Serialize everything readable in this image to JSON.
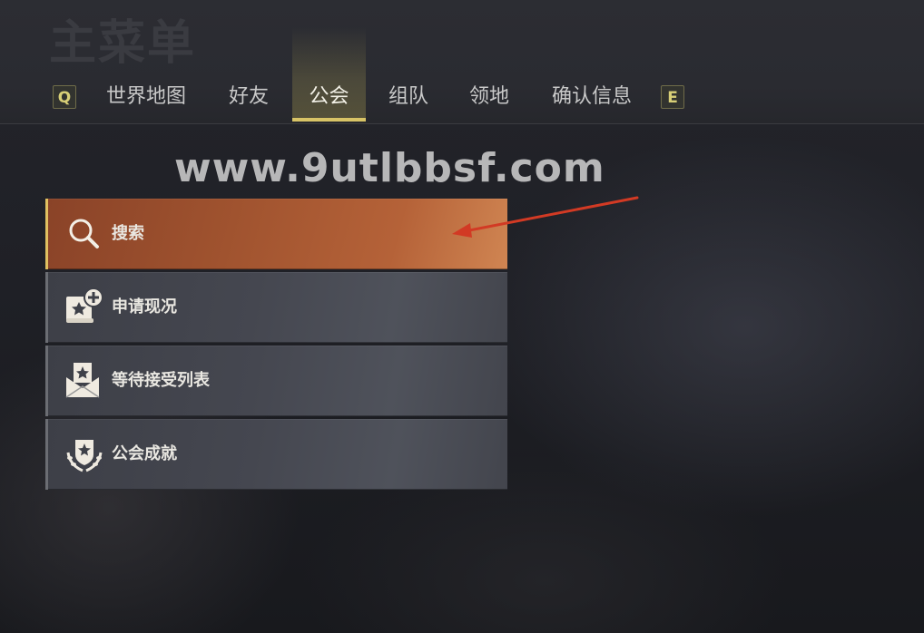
{
  "header": {
    "title": "主菜单",
    "left_key": "Q",
    "right_key": "E",
    "tabs": [
      {
        "label": "世界地图",
        "active": false
      },
      {
        "label": "好友",
        "active": false
      },
      {
        "label": "公会",
        "active": true
      },
      {
        "label": "组队",
        "active": false
      },
      {
        "label": "领地",
        "active": false
      },
      {
        "label": "确认信息",
        "active": false
      }
    ]
  },
  "watermark": "www.9utlbbsf.com",
  "menu": {
    "items": [
      {
        "label": "搜索",
        "icon": "magnifier-icon",
        "selected": true
      },
      {
        "label": "申请现况",
        "icon": "scroll-plus-icon",
        "selected": false
      },
      {
        "label": "等待接受列表",
        "icon": "envelope-star-icon",
        "selected": false
      },
      {
        "label": "公会成就",
        "icon": "shield-laurel-icon",
        "selected": false
      }
    ]
  },
  "colors": {
    "accent_gold": "#d8c466",
    "selected_item": "#a0532f",
    "annotation_arrow": "#d23a24"
  }
}
